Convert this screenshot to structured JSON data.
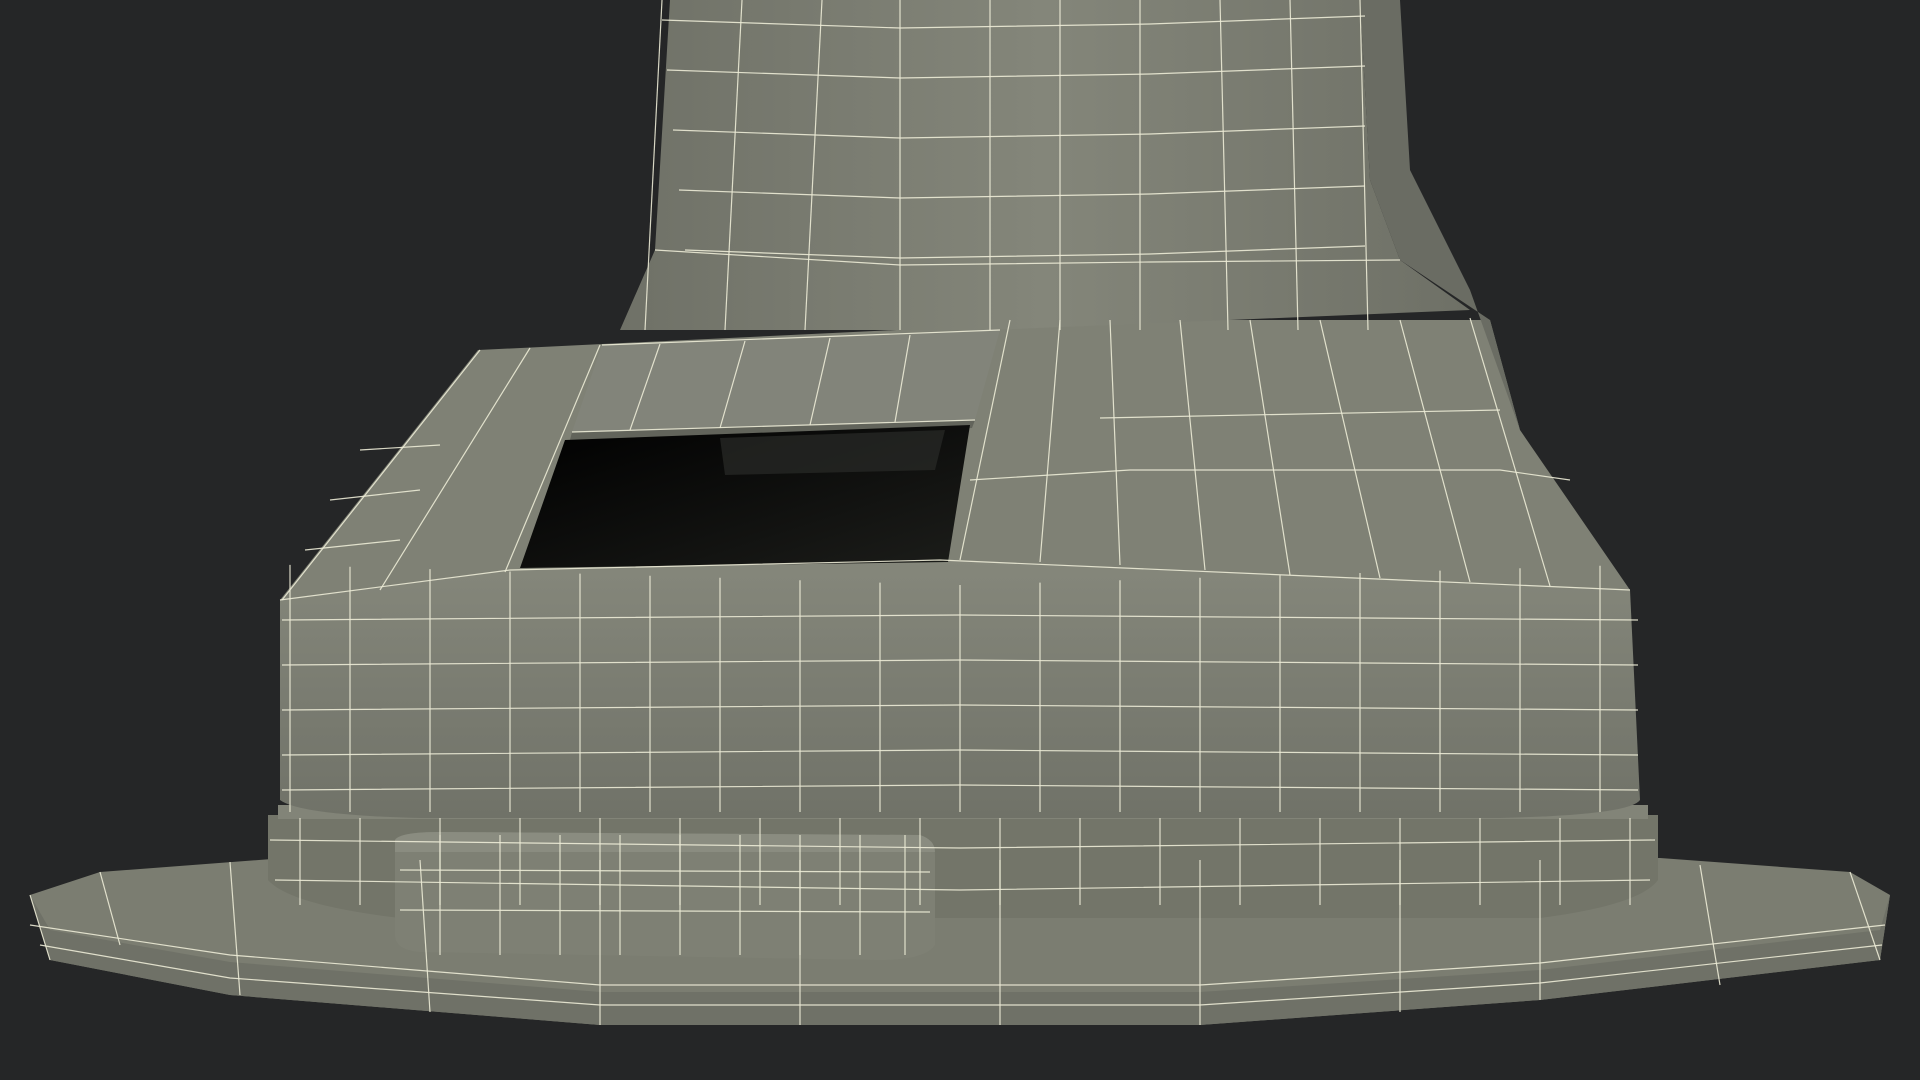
{
  "scene": {
    "background_color": "#252627",
    "surface_color": "#7c7e72",
    "surface_shadow_color": "#5f6158",
    "wire_color": "#ecebd6",
    "opening_color": "#050505",
    "wireframe": true
  }
}
